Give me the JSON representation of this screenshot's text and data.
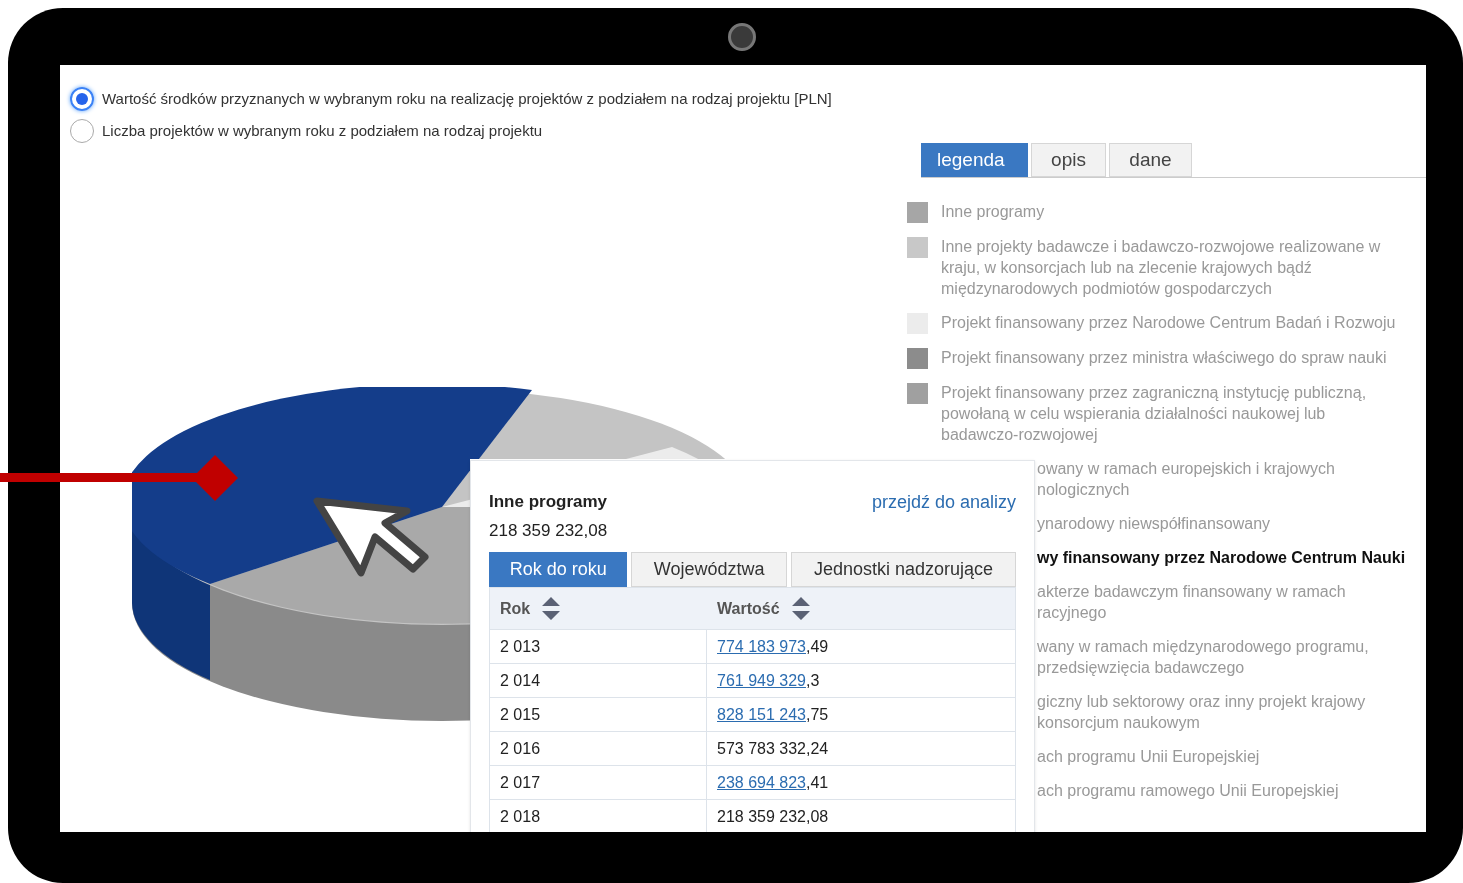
{
  "options": [
    {
      "label": "Wartość środków przyznanych w wybranym roku na realizację projektów z podziałem na rodzaj projektu [PLN]",
      "selected": true
    },
    {
      "label": "Liczba projektów w wybranym roku z podziałem na rodzaj projektu",
      "selected": false
    }
  ],
  "side_tabs": [
    {
      "label": "legenda",
      "selected": true
    },
    {
      "label": "opis",
      "selected": false
    },
    {
      "label": "dane",
      "selected": false
    }
  ],
  "legend": [
    {
      "kind": "full",
      "text": "Inne programy",
      "color": "#a6a6a6",
      "highlighted": false
    },
    {
      "kind": "full",
      "text": "Inne projekty badawcze i badawczo-rozwojowe realizowane w kraju, w konsorcjach lub na zlecenie krajowych bądź międzynarodowych podmiotów gospodarczych",
      "color": "#c8c8c8",
      "highlighted": false
    },
    {
      "kind": "full",
      "text": "Projekt finansowany przez Narodowe Centrum Badań i Rozwoju",
      "color": "#ececec",
      "highlighted": false
    },
    {
      "kind": "full",
      "text": "Projekt finansowany przez ministra właściwego do spraw nauki",
      "color": "#8c8c8c",
      "highlighted": false
    },
    {
      "kind": "full",
      "text": "Projekt finansowany przez zagraniczną instytucję publiczną, powołaną w celu wspierania działalności naukowej lub badawczo-rozwojowej",
      "color": "#a0a0a0",
      "highlighted": false
    },
    {
      "kind": "clipped",
      "text": "owany w ramach europejskich i krajowych\nnologicznych",
      "highlighted": false
    },
    {
      "kind": "clipped",
      "text": "ynarodowy niewspółfinansowany",
      "highlighted": false
    },
    {
      "kind": "clipped",
      "text": "wy finansowany przez Narodowe Centrum Nauki",
      "highlighted": true
    },
    {
      "kind": "clipped",
      "text": "akterze badawczym finansowany w ramach\nracyjnego",
      "highlighted": false
    },
    {
      "kind": "clipped",
      "text": "wany w ramach międzynarodowego programu,\nprzedsięwzięcia badawczego",
      "highlighted": false
    },
    {
      "kind": "clipped",
      "text": "giczny lub sektorowy oraz inny projekt krajowy\nkonsorcjum naukowym",
      "highlighted": false
    },
    {
      "kind": "clipped",
      "text": "ach programu Unii Europejskiej",
      "highlighted": false
    },
    {
      "kind": "clipped",
      "text": "ach programu ramowego Unii Europejskiej",
      "highlighted": false
    }
  ],
  "tooltip": {
    "title": "Inne programy",
    "value": "218 359 232,08",
    "link": "przejdź do analizy",
    "tabs": [
      {
        "label": "Rok do roku",
        "selected": true
      },
      {
        "label": "Województwa",
        "selected": false
      },
      {
        "label": "Jednostki nadzorujące",
        "selected": false
      }
    ],
    "columns": [
      "Rok",
      "Wartość"
    ],
    "rows": [
      {
        "year": "2 013",
        "value": "774 183 973",
        "suffix": ",49",
        "linked": true
      },
      {
        "year": "2 014",
        "value": "761 949 329",
        "suffix": ",3",
        "linked": true
      },
      {
        "year": "2 015",
        "value": "828 151 243",
        "suffix": ",75",
        "linked": true
      },
      {
        "year": "2 016",
        "value": "573 783 332,24",
        "linked": false
      },
      {
        "year": "2 017",
        "value": "238 694 823",
        "suffix": ",41",
        "linked": true
      },
      {
        "year": "2 018",
        "value": "218 359 232,08",
        "linked": false
      }
    ]
  }
}
